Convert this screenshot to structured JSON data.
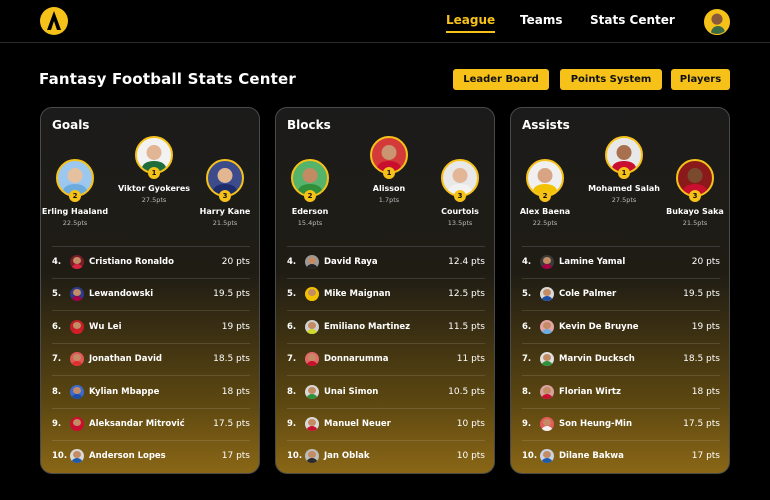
{
  "nav": {
    "links": [
      "League",
      "Teams",
      "Stats Center"
    ],
    "active": "League"
  },
  "page": {
    "title": "Fantasy Football Stats Center",
    "buttons": [
      "Leader Board",
      "Points System",
      "Players"
    ]
  },
  "colors": {
    "accent": "#f6c21a",
    "background": "#000000"
  },
  "cards": [
    {
      "title": "Goals",
      "podium": [
        {
          "rank": "1",
          "name": "Viktor Gyokeres",
          "pts": "27.5pts",
          "face": "#e2b594",
          "shirt": "#1f6d3a",
          "bg": "#f2f2f2"
        },
        {
          "rank": "2",
          "name": "Erling Haaland",
          "pts": "22.5pts",
          "face": "#e6c1a0",
          "shirt": "#6cabdd",
          "bg": "#9cc8ef"
        },
        {
          "rank": "3",
          "name": "Harry Kane",
          "pts": "21.5pts",
          "face": "#e3b692",
          "shirt": "#1d2c6b",
          "bg": "#3b4b8c"
        }
      ],
      "rows": [
        {
          "rank": "4.",
          "name": "Cristiano Ronaldo",
          "pts": "20 pts",
          "shirt": "#d7263d",
          "bg": "#7a1d28"
        },
        {
          "rank": "5.",
          "name": "Lewandowski",
          "pts": "19.5 pts",
          "shirt": "#a50044",
          "bg": "#2c3a8c"
        },
        {
          "rank": "6.",
          "name": "Wu Lei",
          "pts": "19 pts",
          "shirt": "#d21f26",
          "bg": "#c51e26"
        },
        {
          "rank": "7.",
          "name": "Jonathan David",
          "pts": "18.5 pts",
          "shirt": "#e03131",
          "bg": "#e45757"
        },
        {
          "rank": "8.",
          "name": "Kylian Mbappe",
          "pts": "18 pts",
          "shirt": "#1d4ea3",
          "bg": "#3b6bd1"
        },
        {
          "rank": "9.",
          "name": "Aleksandar Mitrović",
          "pts": "17.5 pts",
          "shirt": "#c8102e",
          "bg": "#c8102e"
        },
        {
          "rank": "10.",
          "name": "Anderson Lopes",
          "pts": "17 pts",
          "shirt": "#1e5aa8",
          "bg": "#d9d9d9"
        }
      ]
    },
    {
      "title": "Blocks",
      "podium": [
        {
          "rank": "1",
          "name": "Alisson",
          "pts": "1.7pts",
          "face": "#c99671",
          "shirt": "#c8102e",
          "bg": "#d43a3a"
        },
        {
          "rank": "2",
          "name": "Ederson",
          "pts": "15.4pts",
          "face": "#c38b63",
          "shirt": "#2f8f3a",
          "bg": "#56b36a"
        },
        {
          "rank": "3",
          "name": "Courtois",
          "pts": "13.5pts",
          "face": "#e2b697",
          "shirt": "#f2f2f2",
          "bg": "#e8e8e8"
        }
      ],
      "rows": [
        {
          "rank": "4.",
          "name": "David Raya",
          "pts": "12.4 pts",
          "shirt": "#222222",
          "bg": "#9a9a9a"
        },
        {
          "rank": "5.",
          "name": "Mike Maignan",
          "pts": "12.5 pts",
          "shirt": "#f2c200",
          "bg": "#f2c200"
        },
        {
          "rank": "6.",
          "name": "Emiliano Martinez",
          "pts": "11.5 pts",
          "shirt": "#cfd92b",
          "bg": "#cfcfcf"
        },
        {
          "rank": "7.",
          "name": "Donnarumma",
          "pts": "11 pts",
          "shirt": "#c8102e",
          "bg": "#e16a6a"
        },
        {
          "rank": "8.",
          "name": "Unai Simon",
          "pts": "10.5 pts",
          "shirt": "#2f8f3a",
          "bg": "#d9d9d9"
        },
        {
          "rank": "9.",
          "name": "Manuel Neuer",
          "pts": "10 pts",
          "shirt": "#c8102e",
          "bg": "#d9d9d9"
        },
        {
          "rank": "10.",
          "name": "Jan Oblak",
          "pts": "10 pts",
          "shirt": "#2a2a2a",
          "bg": "#bdbdbd"
        }
      ]
    },
    {
      "title": "Assists",
      "podium": [
        {
          "rank": "1",
          "name": "Mohamed Salah",
          "pts": "27.5pts",
          "face": "#a8704c",
          "shirt": "#c8102e",
          "bg": "#e8e8e8"
        },
        {
          "rank": "2",
          "name": "Alex Baena",
          "pts": "22.5pts",
          "face": "#d9a483",
          "shirt": "#f2c200",
          "bg": "#f0f0f0"
        },
        {
          "rank": "3",
          "name": "Bukayo Saka",
          "pts": "21.5pts",
          "face": "#7a4a2e",
          "shirt": "#c8102e",
          "bg": "#8a1a1a"
        }
      ],
      "rows": [
        {
          "rank": "4.",
          "name": "Lamine Yamal",
          "pts": "20 pts",
          "shirt": "#a50044",
          "bg": "#3a3a3a"
        },
        {
          "rank": "5.",
          "name": "Cole Palmer",
          "pts": "19.5 pts",
          "shirt": "#1d4ea3",
          "bg": "#d9d9d9"
        },
        {
          "rank": "6.",
          "name": "Kevin De Bruyne",
          "pts": "19 pts",
          "shirt": "#6cabdd",
          "bg": "#e6a4a4"
        },
        {
          "rank": "7.",
          "name": "Marvin Ducksch",
          "pts": "18.5 pts",
          "shirt": "#2f8f3a",
          "bg": "#e0e0e0"
        },
        {
          "rank": "8.",
          "name": "Florian Wirtz",
          "pts": "18 pts",
          "shirt": "#c8102e",
          "bg": "#d9a0a0"
        },
        {
          "rank": "9.",
          "name": "Son Heung-Min",
          "pts": "17.5 pts",
          "shirt": "#f2f2f2",
          "bg": "#e55a5a"
        },
        {
          "rank": "10.",
          "name": "Dilane Bakwa",
          "pts": "17 pts",
          "shirt": "#1e5aa8",
          "bg": "#c9d3e8"
        }
      ]
    }
  ]
}
